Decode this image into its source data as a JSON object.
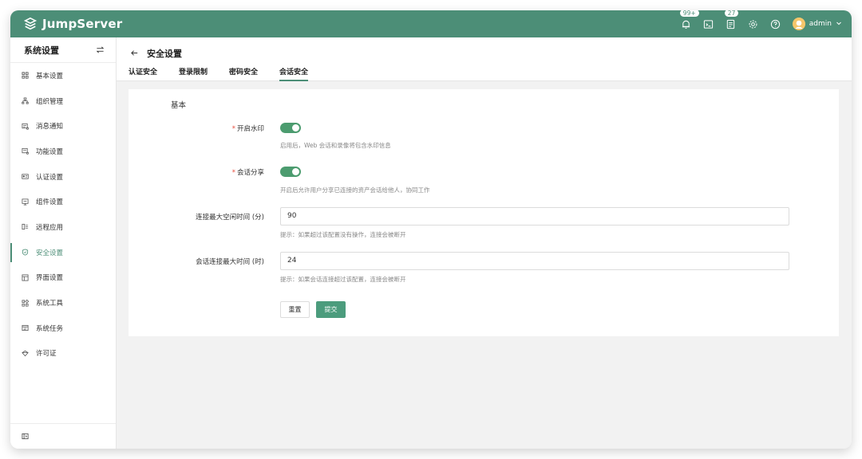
{
  "header": {
    "brand": "JumpServer",
    "notifications_badge": "99+",
    "tickets_badge": "27",
    "username": "admin",
    "accent_color": "#4c8e77"
  },
  "sidebar": {
    "title": "系统设置",
    "items": [
      {
        "label": "基本设置",
        "icon": "grid-icon"
      },
      {
        "label": "组织管理",
        "icon": "org-icon"
      },
      {
        "label": "消息通知",
        "icon": "message-icon"
      },
      {
        "label": "功能设置",
        "icon": "feature-icon"
      },
      {
        "label": "认证设置",
        "icon": "id-card-icon"
      },
      {
        "label": "组件设置",
        "icon": "component-icon"
      },
      {
        "label": "远程应用",
        "icon": "remote-app-icon"
      },
      {
        "label": "安全设置",
        "icon": "shield-icon",
        "active": true
      },
      {
        "label": "界面设置",
        "icon": "layout-icon"
      },
      {
        "label": "系统工具",
        "icon": "tools-icon"
      },
      {
        "label": "系统任务",
        "icon": "task-icon"
      },
      {
        "label": "许可证",
        "icon": "license-icon"
      }
    ]
  },
  "page": {
    "title": "安全设置",
    "tabs": [
      {
        "label": "认证安全"
      },
      {
        "label": "登录限制"
      },
      {
        "label": "密码安全"
      },
      {
        "label": "会话安全",
        "active": true
      }
    ]
  },
  "form": {
    "section_title": "基本",
    "watermark": {
      "label": "开启水印",
      "required_mark": "*",
      "enabled": true,
      "hint": "启用后，Web 会话和录像将包含水印信息"
    },
    "session_share": {
      "label": "会话分享",
      "required_mark": "*",
      "enabled": true,
      "hint": "开启后允许用户分享已连接的资产会话给他人，协同工作"
    },
    "max_idle": {
      "label": "连接最大空闲时间 (分)",
      "value": "90",
      "hint": "提示：如果超过该配置没有操作，连接会被断开"
    },
    "max_session": {
      "label": "会话连接最大时间 (时)",
      "value": "24",
      "hint": "提示：如果会话连接超过该配置，连接会被断开"
    },
    "reset_label": "重置",
    "submit_label": "提交"
  }
}
